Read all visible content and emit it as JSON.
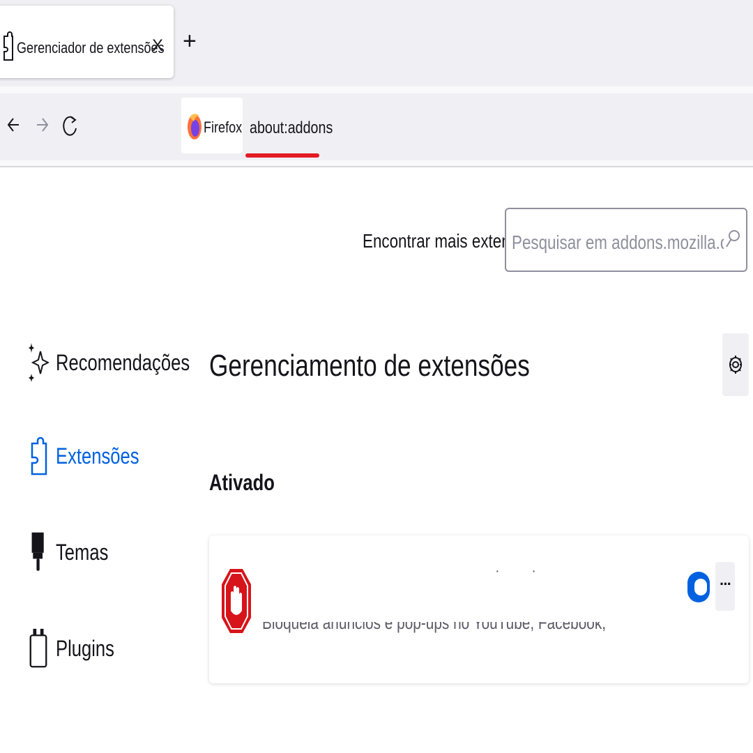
{
  "browser": {
    "tab": {
      "title": "Gerenciador de extensões",
      "close_label": "X",
      "icon": "puzzle-icon"
    },
    "new_tab_label": "+",
    "nav": {
      "back_icon": "←",
      "forward_icon": "→",
      "reload_icon": "C"
    },
    "identity": {
      "label": "Firefox",
      "icon": "firefox-logo-icon"
    },
    "url": "about:addons",
    "accent_underline_color": "#e31b23"
  },
  "header": {
    "find_more_label": "Encontrar mais extensões",
    "search_placeholder": "Pesquisar em addons.mozilla.org",
    "search_value": ""
  },
  "sidebar": {
    "items": [
      {
        "label": "Recomendações",
        "icon": "sparkle-icon",
        "selected": false
      },
      {
        "label": "Extensões",
        "icon": "puzzle-icon",
        "selected": true
      },
      {
        "label": "Temas",
        "icon": "paintbrush-icon",
        "selected": false
      },
      {
        "label": "Plugins",
        "icon": "plugin-icon",
        "selected": false
      }
    ]
  },
  "main": {
    "heading": "Gerenciamento de extensões",
    "settings_icon": "gear-icon",
    "section_heading": "Ativado",
    "addons": [
      {
        "name_visible": "· ·",
        "description": "Bloqueia anúncios e pop-ups no YouTube, Facebook, Twitch e seus sites favoritos.",
        "icon": "stop-hand-icon",
        "enabled": true,
        "more_label": "···"
      }
    ]
  },
  "colors": {
    "selected": "#0061e0",
    "toggle_on": "#0061e0",
    "addon_icon": "#d7141a"
  }
}
